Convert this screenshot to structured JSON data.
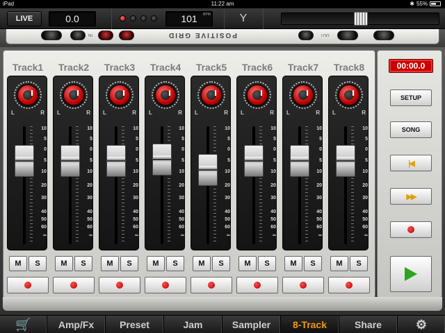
{
  "status_bar": {
    "carrier": "iPad",
    "time": "11:22 am",
    "battery": "55%"
  },
  "toolbar": {
    "mode_button": "LIVE",
    "input_level": "0.0",
    "tempo": "101",
    "tempo_unit": "BPM",
    "master_volume_fraction": 0.5
  },
  "hardware": {
    "brand": "POSITIVE GRID",
    "in_label": "IN",
    "out_label": "OUT"
  },
  "tracks": [
    {
      "name": "Track1",
      "fader_level": 0.78
    },
    {
      "name": "Track2",
      "fader_level": 0.78
    },
    {
      "name": "Track3",
      "fader_level": 0.78
    },
    {
      "name": "Track4",
      "fader_level": 0.8
    },
    {
      "name": "Track5",
      "fader_level": 0.68
    },
    {
      "name": "Track6",
      "fader_level": 0.78
    },
    {
      "name": "Track7",
      "fader_level": 0.78
    },
    {
      "name": "Track8",
      "fader_level": 0.78
    }
  ],
  "strip_labels": {
    "pan_left": "L",
    "pan_right": "R",
    "mute": "M",
    "solo": "S"
  },
  "fader_scale": [
    "10",
    "5",
    "0",
    "5",
    "10",
    "20",
    "30",
    "40",
    "50",
    "60",
    "∞"
  ],
  "transport": {
    "timer": "00:00.0",
    "setup": "SETUP",
    "song": "SONG",
    "rewind_glyph": "|◀",
    "fast_forward_glyph": "▶▶"
  },
  "tabs": [
    {
      "label": "Amp/Fx",
      "active": false
    },
    {
      "label": "Preset",
      "active": false
    },
    {
      "label": "Jam",
      "active": false
    },
    {
      "label": "Sampler",
      "active": false
    },
    {
      "label": "8-Track",
      "active": true
    },
    {
      "label": "Share",
      "active": false
    }
  ],
  "icons": {
    "store": "cart-icon",
    "settings": "gear-icon",
    "tuner": "tuning-fork-icon"
  },
  "colors": {
    "accent": "#f39a0e",
    "record": "#c70000",
    "play": "#2ea31f"
  }
}
